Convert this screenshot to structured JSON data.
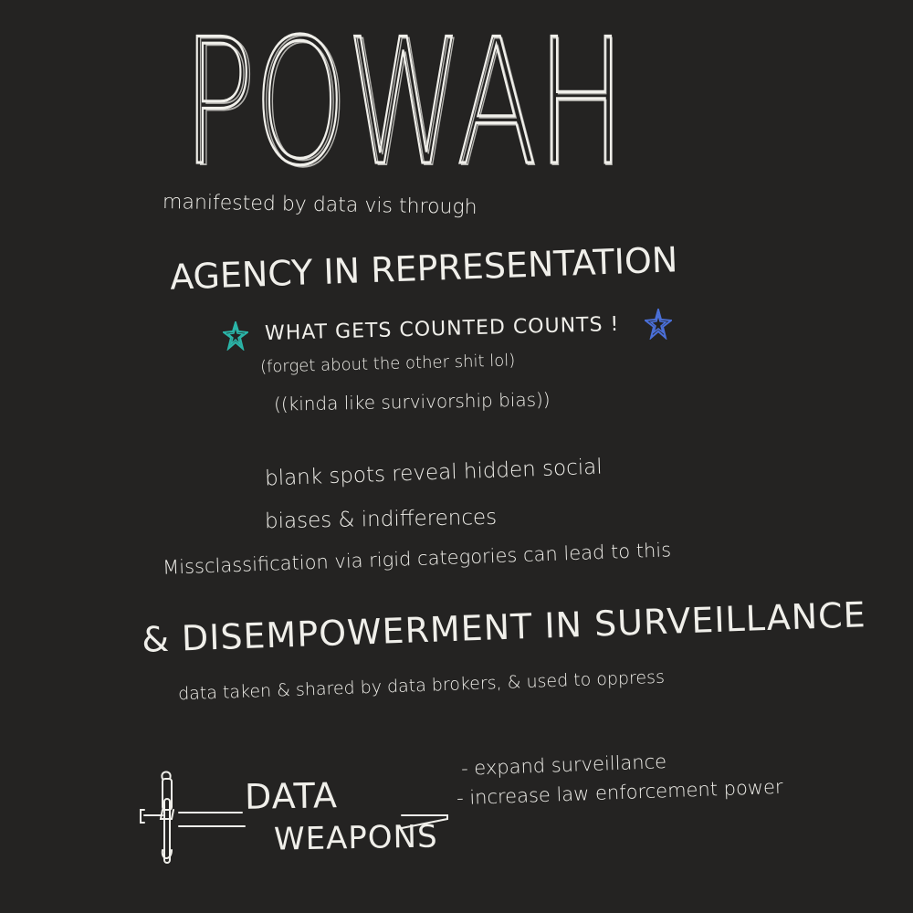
{
  "title": "POWAH",
  "subtitle": "manifested by data vis through",
  "section1": {
    "heading": "AGENCY IN REPRESENTATION",
    "point1": "WHAT GETS COUNTED COUNTS !",
    "point1_aside": "(forget about the other shit lol)",
    "point1_aside2": "((kinda like survivorship bias))",
    "point2_line1": "blank spots reveal hidden social",
    "point2_line2": "biases & indifferences"
  },
  "bridge": "Missclassification via rigid categories can lead to this",
  "section2": {
    "heading": "& DISEMPOWERMENT IN SURVEILLANCE",
    "point": "data taken & shared by data brokers, & used to oppress",
    "bullets": [
      "- expand surveillance",
      "- increase law enforcement power"
    ],
    "label_line1": "DATA",
    "label_line2": "WEAPONS"
  },
  "colors": {
    "background": "#242322",
    "ink": "#f0efea",
    "star_left": "#2bb5a8",
    "star_right": "#4a6fd8"
  },
  "icons": [
    "star-icon",
    "star-icon",
    "sword-icon"
  ]
}
